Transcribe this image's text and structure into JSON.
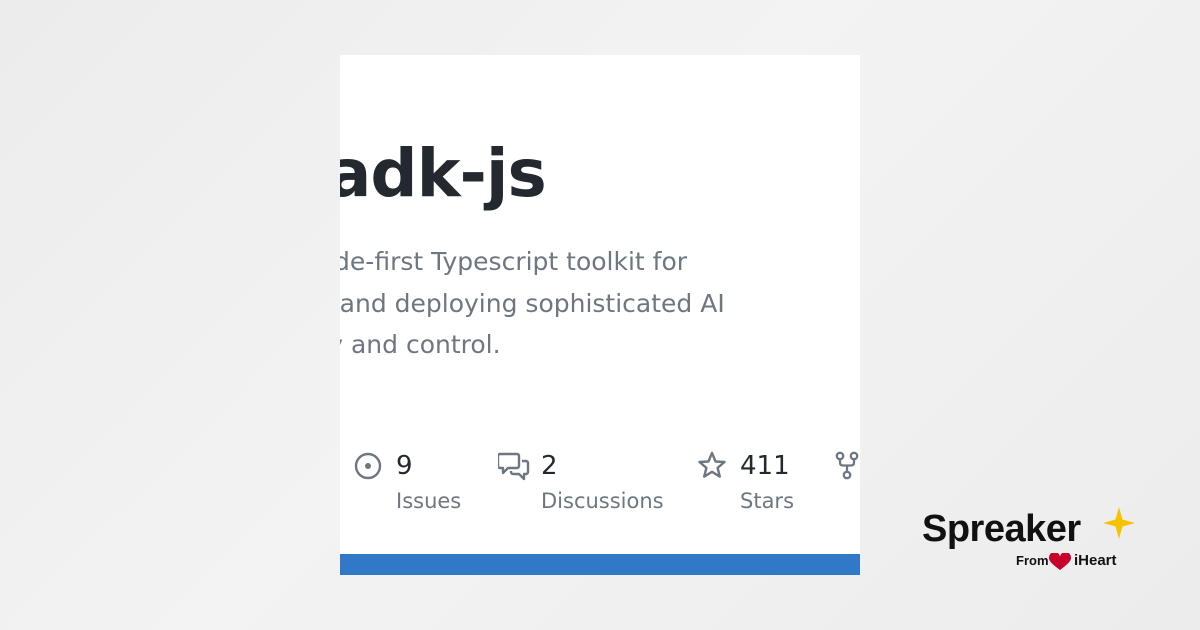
{
  "repo": {
    "title_visible": "e/adk-js",
    "description_lines": [
      "ce, code-first Typescript toolkit for",
      "ating, and deploying sophisticated AI",
      "xibility and control."
    ]
  },
  "stats": [
    {
      "icon": "issue-circle-icon",
      "count": "9",
      "label": "Issues"
    },
    {
      "icon": "discussion-bubbles-icon",
      "count": "2",
      "label": "Discussions"
    },
    {
      "icon": "star-icon",
      "count": "411",
      "label": "Stars"
    },
    {
      "icon": "fork-icon",
      "count": "",
      "label": ""
    }
  ],
  "accent": {
    "bar_color": "#3178c6",
    "text_dark": "#24292f",
    "text_muted": "#6e7781"
  },
  "brand": {
    "name": "Spreaker",
    "from": "From",
    "partner": "iHeart",
    "star_color": "#f5c400",
    "heart_color": "#c6002b"
  }
}
